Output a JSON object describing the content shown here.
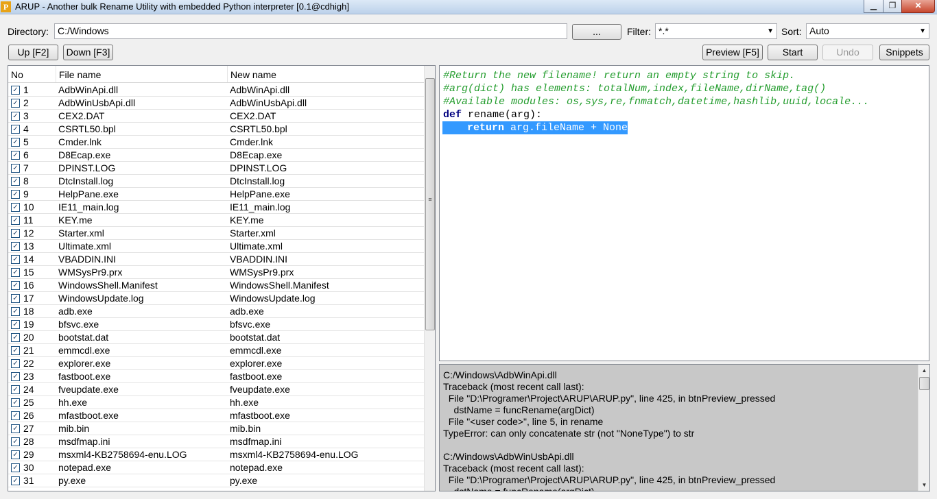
{
  "window": {
    "title": "ARUP - Another bulk Rename Utility with embedded Python interpreter [0.1@cdhigh]",
    "icon_letter": "P",
    "minimize": "▁",
    "maximize": "❐",
    "close": "✕"
  },
  "toolbar": {
    "directory_label": "Directory:",
    "directory_value": "C:/Windows",
    "browse_label": "...",
    "filter_label": "Filter:",
    "filter_value": "*.*",
    "sort_label": "Sort:",
    "sort_value": "Auto",
    "up_label": "Up [F2]",
    "down_label": "Down [F3]",
    "preview_label": "Preview [F5]",
    "start_label": "Start",
    "undo_label": "Undo",
    "snippets_label": "Snippets"
  },
  "table": {
    "headers": [
      "No",
      "File name",
      "New name"
    ],
    "rows": [
      {
        "no": "1",
        "file": "AdbWinApi.dll",
        "new": "AdbWinApi.dll"
      },
      {
        "no": "2",
        "file": "AdbWinUsbApi.dll",
        "new": "AdbWinUsbApi.dll"
      },
      {
        "no": "3",
        "file": "CEX2.DAT",
        "new": "CEX2.DAT"
      },
      {
        "no": "4",
        "file": "CSRTL50.bpl",
        "new": "CSRTL50.bpl"
      },
      {
        "no": "5",
        "file": "Cmder.lnk",
        "new": "Cmder.lnk"
      },
      {
        "no": "6",
        "file": "D8Ecap.exe",
        "new": "D8Ecap.exe"
      },
      {
        "no": "7",
        "file": "DPINST.LOG",
        "new": "DPINST.LOG"
      },
      {
        "no": "8",
        "file": "DtcInstall.log",
        "new": "DtcInstall.log"
      },
      {
        "no": "9",
        "file": "HelpPane.exe",
        "new": "HelpPane.exe"
      },
      {
        "no": "10",
        "file": "IE11_main.log",
        "new": "IE11_main.log"
      },
      {
        "no": "11",
        "file": "KEY.me",
        "new": "KEY.me"
      },
      {
        "no": "12",
        "file": "Starter.xml",
        "new": "Starter.xml"
      },
      {
        "no": "13",
        "file": "Ultimate.xml",
        "new": "Ultimate.xml"
      },
      {
        "no": "14",
        "file": "VBADDIN.INI",
        "new": "VBADDIN.INI"
      },
      {
        "no": "15",
        "file": "WMSysPr9.prx",
        "new": "WMSysPr9.prx"
      },
      {
        "no": "16",
        "file": "WindowsShell.Manifest",
        "new": "WindowsShell.Manifest"
      },
      {
        "no": "17",
        "file": "WindowsUpdate.log",
        "new": "WindowsUpdate.log"
      },
      {
        "no": "18",
        "file": "adb.exe",
        "new": "adb.exe"
      },
      {
        "no": "19",
        "file": "bfsvc.exe",
        "new": "bfsvc.exe"
      },
      {
        "no": "20",
        "file": "bootstat.dat",
        "new": "bootstat.dat"
      },
      {
        "no": "21",
        "file": "emmcdl.exe",
        "new": "emmcdl.exe"
      },
      {
        "no": "22",
        "file": "explorer.exe",
        "new": "explorer.exe"
      },
      {
        "no": "23",
        "file": "fastboot.exe",
        "new": "fastboot.exe"
      },
      {
        "no": "24",
        "file": "fveupdate.exe",
        "new": "fveupdate.exe"
      },
      {
        "no": "25",
        "file": "hh.exe",
        "new": "hh.exe"
      },
      {
        "no": "26",
        "file": "mfastboot.exe",
        "new": "mfastboot.exe"
      },
      {
        "no": "27",
        "file": "mib.bin",
        "new": "mib.bin"
      },
      {
        "no": "28",
        "file": "msdfmap.ini",
        "new": "msdfmap.ini"
      },
      {
        "no": "29",
        "file": "msxml4-KB2758694-enu.LOG",
        "new": "msxml4-KB2758694-enu.LOG"
      },
      {
        "no": "30",
        "file": "notepad.exe",
        "new": "notepad.exe"
      },
      {
        "no": "31",
        "file": "py.exe",
        "new": "py.exe"
      }
    ]
  },
  "editor": {
    "lines": [
      "#Return the new filename! return an empty string to skip.",
      "#arg(dict) has elements: totalNum,index,fileName,dirName,tag()",
      "#Available modules: os,sys,re,fnmatch,datetime,hashlib,uuid,locale..."
    ],
    "def_keyword": "def",
    "def_rest": " rename(arg):",
    "return_indent": "    ",
    "return_keyword": "return",
    "return_rest": " arg.fileName + None"
  },
  "output": {
    "lines": [
      "C:/Windows\\AdbWinApi.dll",
      "Traceback (most recent call last):",
      "  File \"D:\\Programer\\Project\\ARUP\\ARUP.py\", line 425, in btnPreview_pressed",
      "    dstName = funcRename(argDict)",
      "  File \"<user code>\", line 5, in rename",
      "TypeError: can only concatenate str (not \"NoneType\") to str",
      "",
      "C:/Windows\\AdbWinUsbApi.dll",
      "Traceback (most recent call last):",
      "  File \"D:\\Programer\\Project\\ARUP\\ARUP.py\", line 425, in btnPreview_pressed",
      "    dstName = funcRename(argDict)"
    ]
  },
  "icons": {
    "checkbox": "✓",
    "combo_arrow": "▼",
    "scroll_up": "▲",
    "scroll_down": "▼",
    "grip": "≡"
  }
}
